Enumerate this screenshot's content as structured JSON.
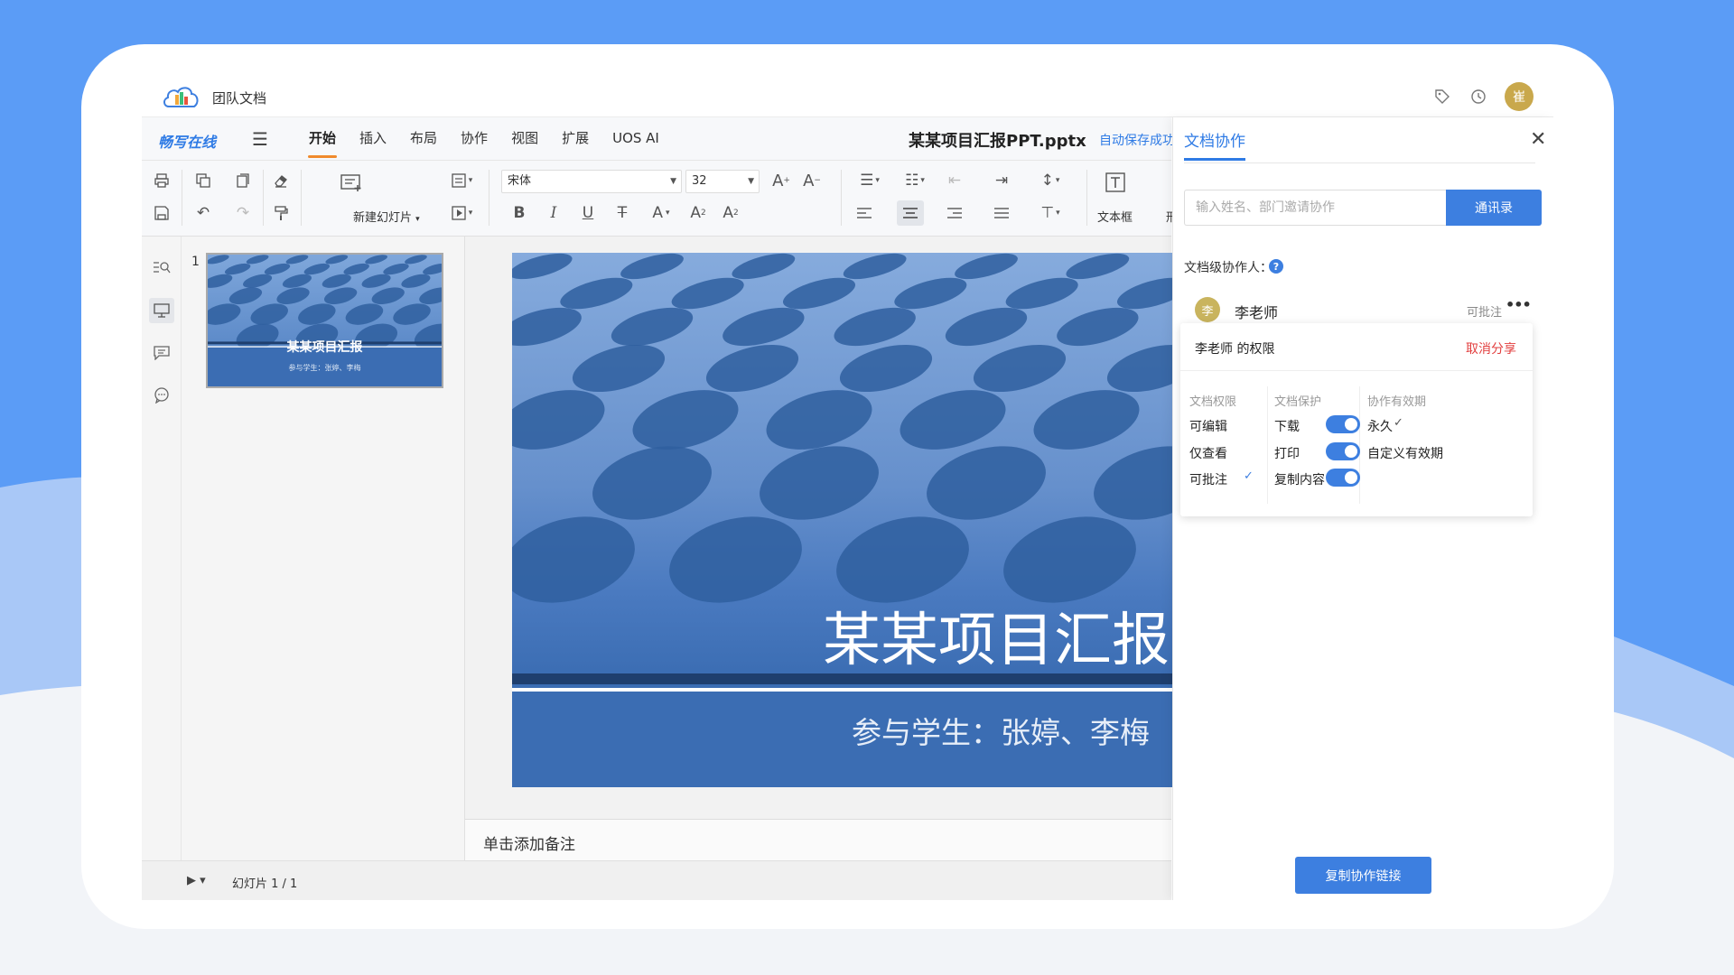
{
  "app": {
    "title": "团队文档"
  },
  "menubar": {
    "brand": "畅写在线",
    "items": [
      "开始",
      "插入",
      "布局",
      "协作",
      "视图",
      "扩展",
      "UOS AI"
    ],
    "active_index": 0,
    "filename": "某某项目汇报PPT.pptx",
    "autosave": "自动保存成功"
  },
  "toolbar": {
    "new_slide_label": "新建幻灯片",
    "font_name": "宋体",
    "font_size": "32",
    "textbox_label": "文本框",
    "cut_label": "形"
  },
  "slides": {
    "number": "1",
    "title": "某某项目汇报",
    "subtitle": "参与学生：张婷、李梅"
  },
  "notes": {
    "placeholder": "单击添加备注"
  },
  "status": {
    "slide_info": "幻灯片 1 / 1"
  },
  "panel": {
    "tab_label": "文档协作",
    "invite_placeholder": "输入姓名、部门邀请协作",
    "contacts_button": "通讯录",
    "collaborators_label": "文档级协作人：",
    "help_glyph": "?",
    "collaborator": {
      "avatar_char": "李",
      "name": "李老师",
      "permission": "可批注"
    },
    "popup": {
      "title": "李老师 的权限",
      "cancel_share": "取消分享",
      "doc_perm_header": "文档权限",
      "doc_perm_options": [
        "可编辑",
        "仅查看",
        "可批注"
      ],
      "doc_perm_selected": 2,
      "protect_header": "文档保护",
      "protect_options": [
        "下载",
        "打印",
        "复制内容"
      ],
      "protect_states": [
        true,
        true,
        true
      ],
      "validity_header": "协作有效期",
      "validity_options": [
        "永久",
        "自定义有效期"
      ],
      "validity_selected": 0
    },
    "copy_link_button": "复制协作链接"
  },
  "user": {
    "avatar_char": "崔"
  },
  "colors": {
    "accent": "#3d7fe0",
    "brand": "#2f7be5",
    "menu_underline": "#f08a2c",
    "danger": "#e23e3e",
    "background": "#5b9cf6",
    "slide": "#3b6db3"
  }
}
